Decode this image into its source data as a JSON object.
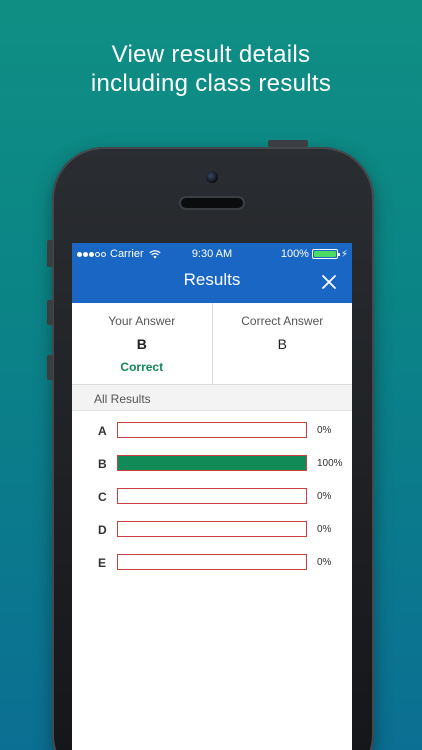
{
  "promo": {
    "line1": "View result details",
    "line2": "including class results"
  },
  "status_bar": {
    "carrier": "Carrier",
    "time": "9:30 AM",
    "battery": "100%",
    "icons": [
      "signal-dots-icon",
      "wifi-icon",
      "battery-icon",
      "bolt-icon"
    ]
  },
  "header": {
    "title": "Results",
    "close_icon": "close-icon"
  },
  "answers": {
    "your_label": "Your Answer",
    "your_value": "B",
    "verdict": "Correct",
    "correct_label": "Correct Answer",
    "correct_value": "B"
  },
  "section": {
    "label": "All Results"
  },
  "results": [
    {
      "letter": "A",
      "percent": 0,
      "label": "0%"
    },
    {
      "letter": "B",
      "percent": 100,
      "label": "100%"
    },
    {
      "letter": "C",
      "percent": 0,
      "label": "0%"
    },
    {
      "letter": "D",
      "percent": 0,
      "label": "0%"
    },
    {
      "letter": "E",
      "percent": 0,
      "label": "0%"
    }
  ],
  "colors": {
    "header": "#1a66c4",
    "correct": "#128a57",
    "bar_border": "#c9413f",
    "background_top": "#0f8f84",
    "background_bottom": "#0b6f93"
  }
}
